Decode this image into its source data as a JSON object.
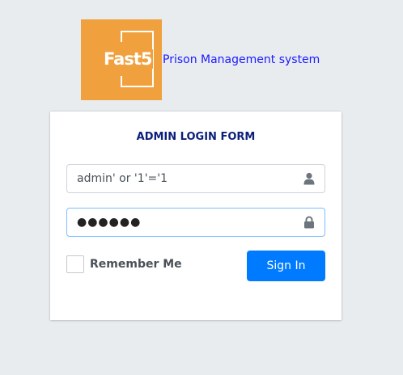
{
  "brand": {
    "logo_text": "Fast5",
    "app_title": "Prison Management system",
    "logo_color": "#f0a03c",
    "title_color": "#1a1aff"
  },
  "form": {
    "title": "ADMIN LOGIN FORM",
    "username_value": "admin' or '1'='1",
    "password_masked": "●●●●●●",
    "remember_label": "Remember Me",
    "signin_label": "Sign In",
    "accent_color": "#007bff"
  },
  "icons": {
    "username": "user-icon",
    "password": "lock-icon"
  }
}
